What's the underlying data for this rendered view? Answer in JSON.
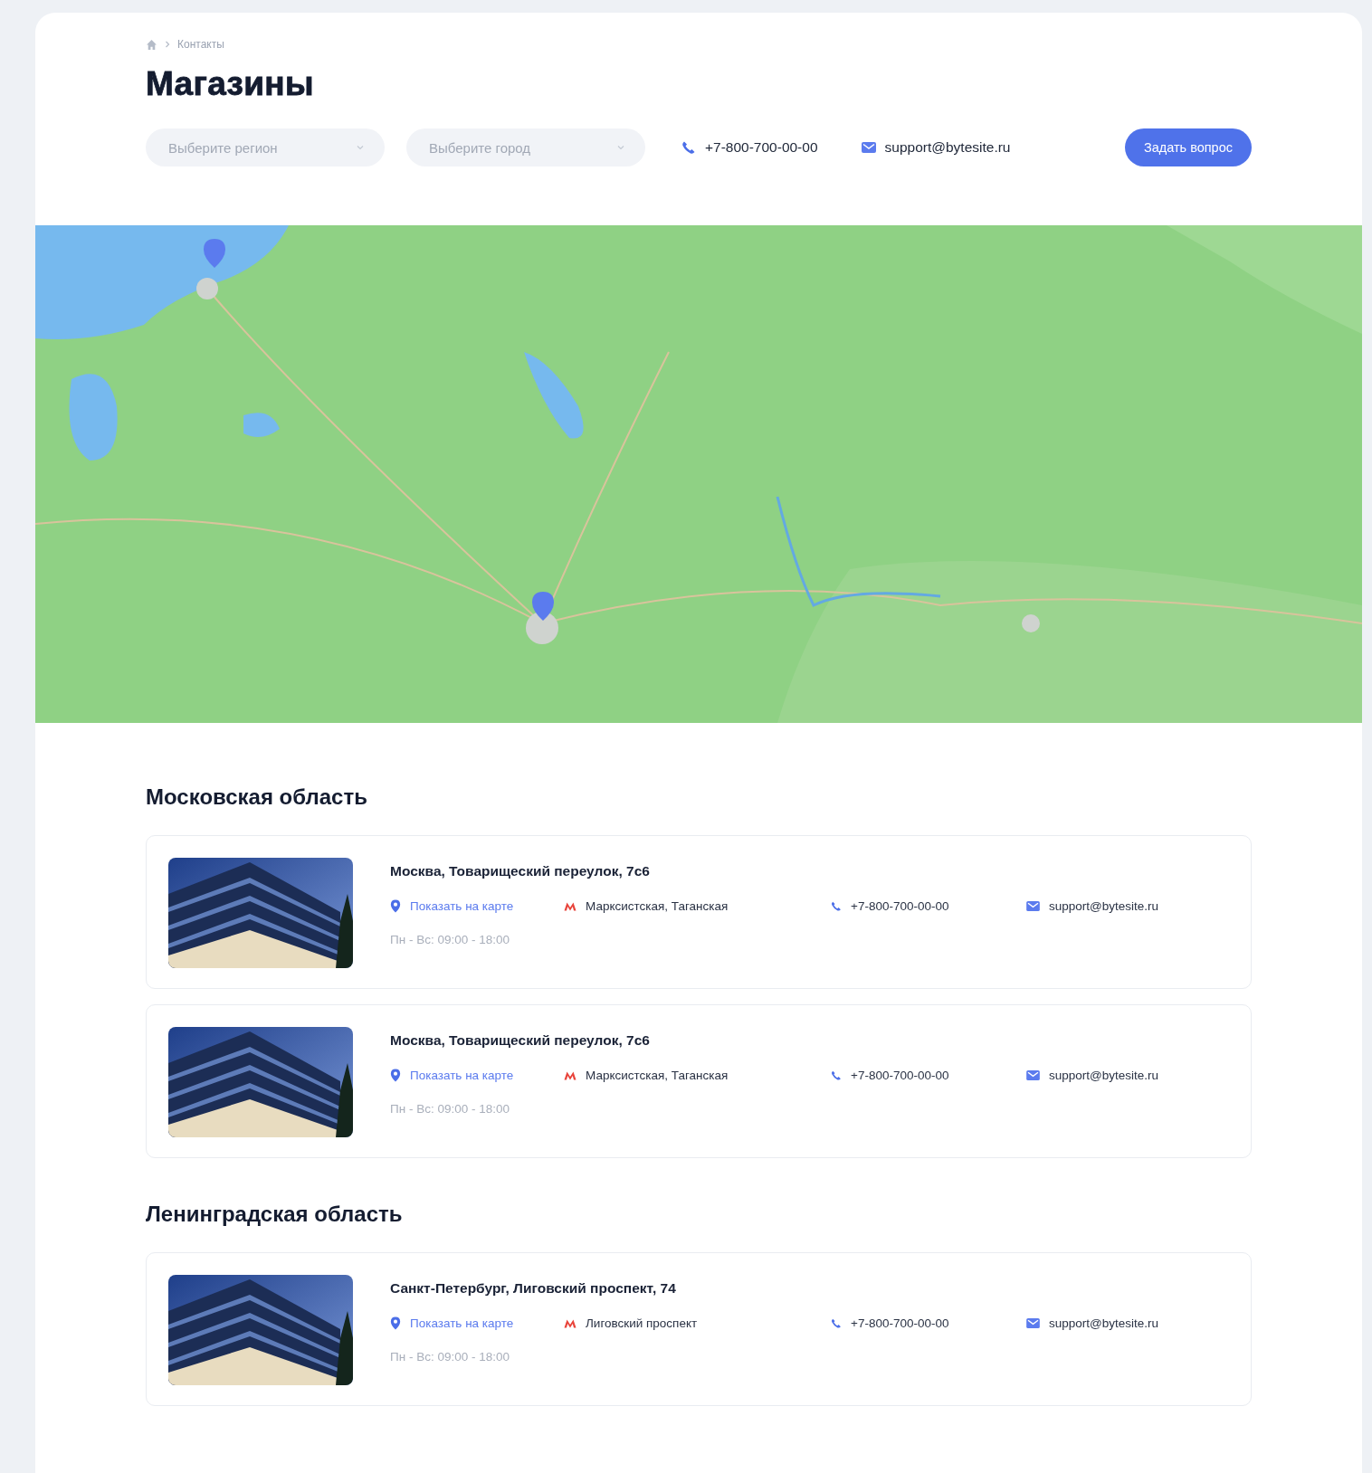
{
  "breadcrumb": {
    "current": "Контакты"
  },
  "title": "Магазины",
  "filters": [
    {
      "placeholder": "Выберите регион"
    },
    {
      "placeholder": "Выберите город"
    }
  ],
  "contacts": {
    "phone": "+7-800-700-00-00",
    "email": "support@bytesite.ru"
  },
  "ask_button": "Задать вопрос",
  "regions": [
    {
      "name": "Московская область",
      "stores": [
        {
          "address": "Москва, Товарищеский переулок, 7с6",
          "map_link": "Показать на карте",
          "metro": "Марксистская, Таганская",
          "phone": "+7-800-700-00-00",
          "email": "support@bytesite.ru",
          "hours": "Пн - Вс: 09:00 - 18:00"
        },
        {
          "address": "Москва, Товарищеский переулок, 7с6",
          "map_link": "Показать на карте",
          "metro": "Марксистская, Таганская",
          "phone": "+7-800-700-00-00",
          "email": "support@bytesite.ru",
          "hours": "Пн - Вс: 09:00 - 18:00"
        }
      ]
    },
    {
      "name": "Ленинградская область",
      "stores": [
        {
          "address": "Санкт-Петербург, Лиговский проспект, 74",
          "map_link": "Показать на карте",
          "metro": "Лиговский проспект",
          "phone": "+7-800-700-00-00",
          "email": "support@bytesite.ru",
          "hours": "Пн - Вс: 09:00 - 18:00"
        }
      ]
    }
  ]
}
